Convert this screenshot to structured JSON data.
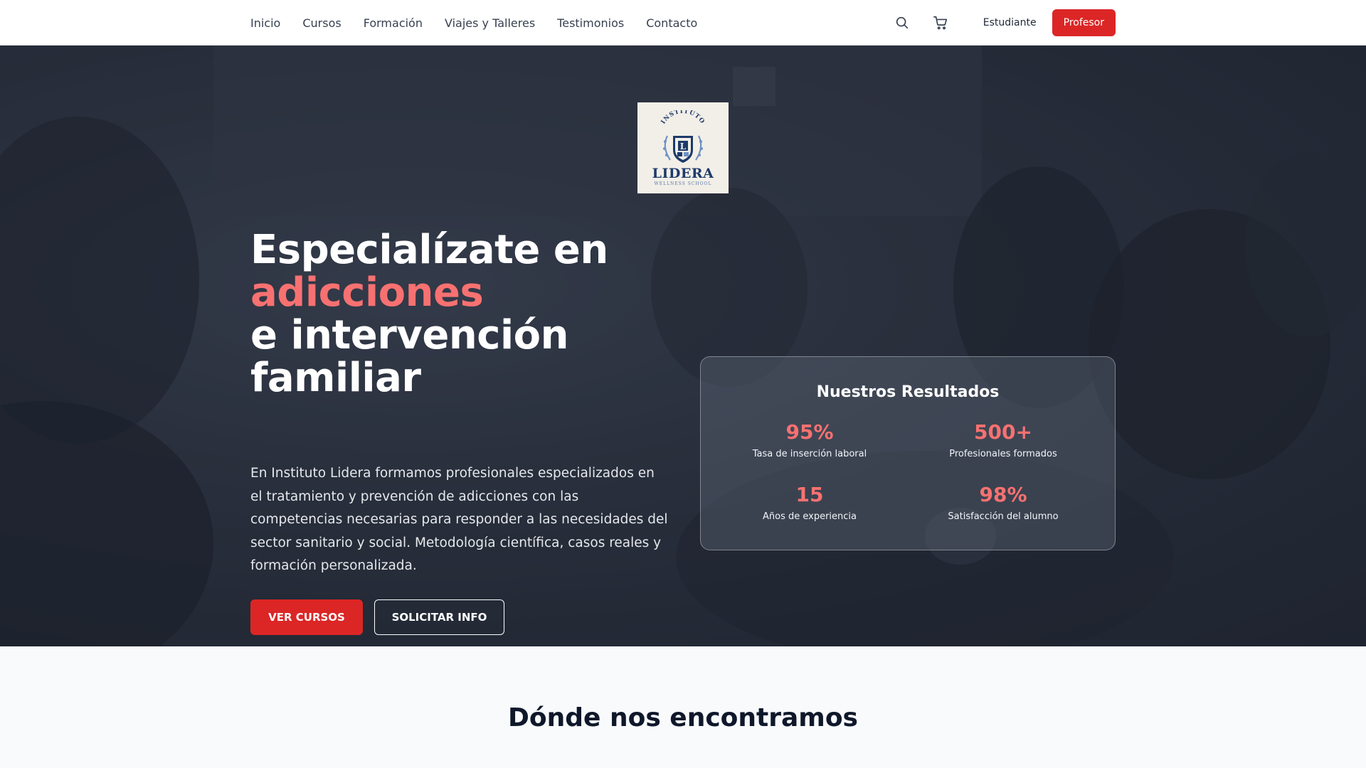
{
  "nav": {
    "links": [
      "Inicio",
      "Cursos",
      "Formación",
      "Viajes y Talleres",
      "Testimonios",
      "Contacto"
    ],
    "search_icon": "search-icon",
    "cart_icon": "cart-icon",
    "student_label": "Estudiante",
    "teacher_label": "Profesor"
  },
  "logo": {
    "top_text": "INSTITUTO",
    "letter": "L",
    "name": "LIDERA",
    "subtitle": "WELLNESS SCHOOL"
  },
  "hero": {
    "title_line1": "Especialízate en",
    "title_accent": "adicciones",
    "title_line3": "e intervención",
    "title_line4": "familiar",
    "description": "En Instituto Lidera formamos profesionales especializados en el tratamiento y prevención de adicciones con las competencias necesarias para responder a las necesidades del sector sanitario y social. Metodología científica, casos reales y formación personalizada.",
    "primary_button": "VER CURSOS",
    "secondary_button": "SOLICITAR INFO"
  },
  "results": {
    "title": "Nuestros Resultados",
    "stats": [
      {
        "value": "95%",
        "label": "Tasa de inserción laboral"
      },
      {
        "value": "500+",
        "label": "Profesionales formados"
      },
      {
        "value": "15",
        "label": "Años de experiencia"
      },
      {
        "value": "98%",
        "label": "Satisfacción del alumno"
      }
    ]
  },
  "location": {
    "title": "Dónde nos encontramos"
  },
  "colors": {
    "accent": "#dc2626",
    "accent_light": "#f87171",
    "hero_bg": "#2c3340",
    "logo_navy": "#1e3a6a"
  }
}
